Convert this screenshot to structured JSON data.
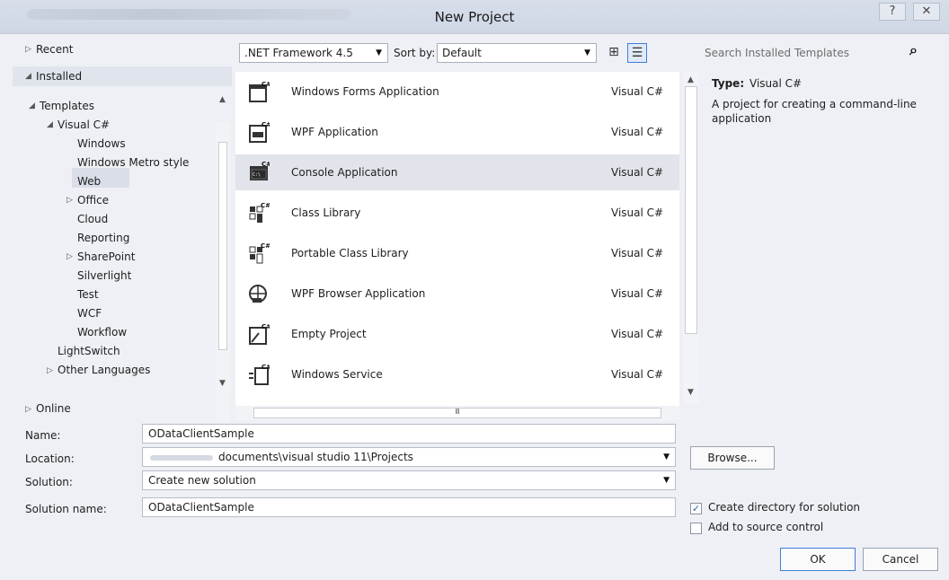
{
  "window": {
    "title": "New Project",
    "help_glyph": "?",
    "close_glyph": "✕"
  },
  "left_tree": {
    "recent": "Recent",
    "installed": "Installed",
    "templates": "Templates",
    "visual_csharp": "Visual C#",
    "items": [
      "Windows",
      "Windows Metro style",
      "Web",
      "Office",
      "Cloud",
      "Reporting",
      "SharePoint",
      "Silverlight",
      "Test",
      "WCF",
      "Workflow"
    ],
    "lightswitch": "LightSwitch",
    "other_languages": "Other Languages",
    "online": "Online"
  },
  "toolbar": {
    "framework": ".NET Framework 4.5",
    "sort_label": "Sort by:",
    "sort_value": "Default"
  },
  "templates": [
    {
      "name": "Windows Forms Application",
      "lang": "Visual C#",
      "icon": "windows-forms-icon"
    },
    {
      "name": "WPF Application",
      "lang": "Visual C#",
      "icon": "wpf-icon"
    },
    {
      "name": "Console Application",
      "lang": "Visual C#",
      "icon": "console-icon"
    },
    {
      "name": "Class Library",
      "lang": "Visual C#",
      "icon": "class-library-icon"
    },
    {
      "name": "Portable Class Library",
      "lang": "Visual C#",
      "icon": "portable-class-library-icon"
    },
    {
      "name": "WPF Browser Application",
      "lang": "Visual C#",
      "icon": "wpf-browser-icon"
    },
    {
      "name": "Empty Project",
      "lang": "Visual C#",
      "icon": "empty-project-icon"
    },
    {
      "name": "Windows Service",
      "lang": "Visual C#",
      "icon": "windows-service-icon"
    }
  ],
  "search": {
    "placeholder": "Search Installed Templates"
  },
  "details": {
    "type_label": "Type:",
    "type_value": "Visual C#",
    "description": "A project for creating a command-line application"
  },
  "form": {
    "name_label": "Name:",
    "name_value": "ODataClientSample",
    "location_label": "Location:",
    "location_value": "documents\\visual studio 11\\Projects",
    "solution_label": "Solution:",
    "solution_value": "Create new solution",
    "solution_name_label": "Solution name:",
    "solution_name_value": "ODataClientSample",
    "browse": "Browse...",
    "create_directory": "Create directory for solution",
    "create_directory_checked": true,
    "add_source_control": "Add to source control",
    "add_source_control_checked": false,
    "ok": "OK",
    "cancel": "Cancel"
  },
  "colors": {
    "selection": "#e1e4ea",
    "dialog_bg": "#eef0f5",
    "titlebar": "#d7deea"
  }
}
